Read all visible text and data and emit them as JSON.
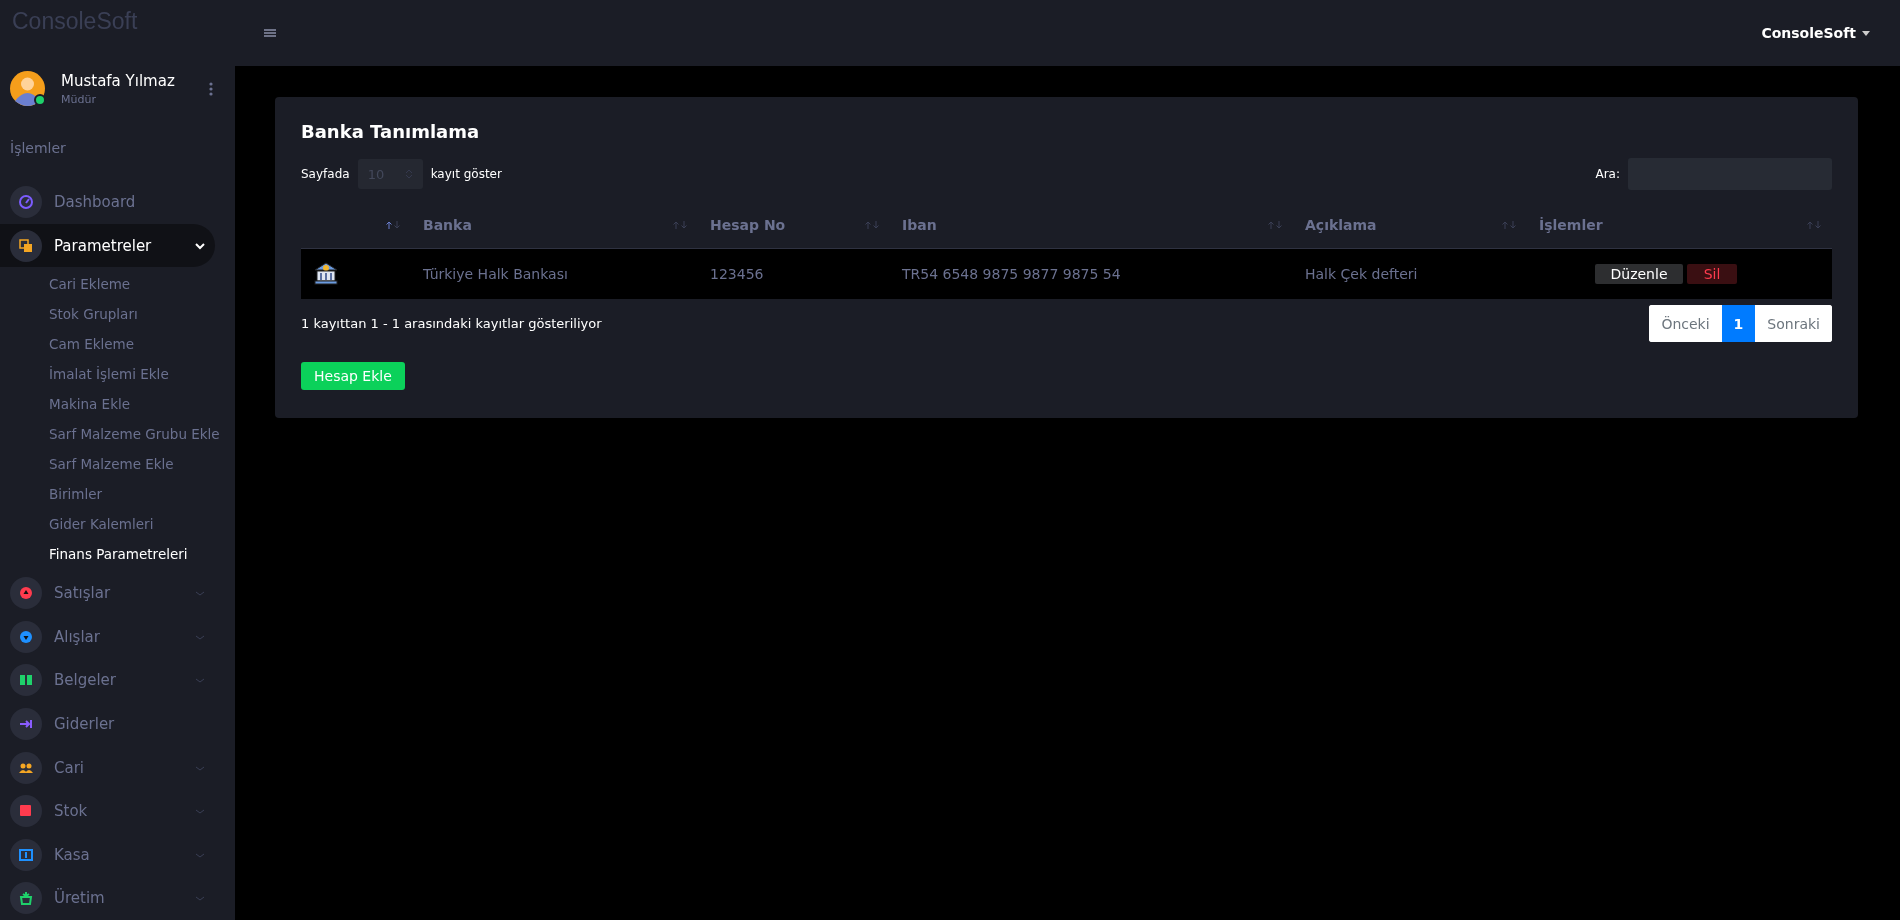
{
  "brand": "ConsoleSoft",
  "topbar": {
    "user_menu": "ConsoleSoft"
  },
  "user": {
    "name": "Mustafa Yılmaz",
    "role": "Müdür",
    "online": true
  },
  "sidebar": {
    "section": "İşlemler",
    "items": [
      {
        "label": "Dashboard",
        "kind": "link",
        "color": "#7c5cff",
        "selected": false
      },
      {
        "label": "Parametreler",
        "kind": "group",
        "color": "#f5a623",
        "selected": true,
        "expanded": true,
        "children": [
          {
            "label": "Cari Ekleme",
            "selected": false
          },
          {
            "label": "Stok Grupları",
            "selected": false
          },
          {
            "label": "Cam Ekleme",
            "selected": false
          },
          {
            "label": "İmalat İşlemi Ekle",
            "selected": false
          },
          {
            "label": "Makina Ekle",
            "selected": false
          },
          {
            "label": "Sarf Malzeme Grubu Ekle",
            "selected": false
          },
          {
            "label": "Sarf Malzeme Ekle",
            "selected": false
          },
          {
            "label": "Birimler",
            "selected": false
          },
          {
            "label": "Gider Kalemleri",
            "selected": false
          },
          {
            "label": "Finans Parametreleri",
            "selected": true
          }
        ]
      },
      {
        "label": "Satışlar",
        "kind": "group",
        "color": "#ff3b4e",
        "selected": false,
        "expanded": false
      },
      {
        "label": "Alışlar",
        "kind": "group",
        "color": "#1e90ff",
        "selected": false,
        "expanded": false
      },
      {
        "label": "Belgeler",
        "kind": "group",
        "color": "#1fd16b",
        "selected": false,
        "expanded": false
      },
      {
        "label": "Giderler",
        "kind": "link",
        "color": "#8a5cff",
        "selected": false
      },
      {
        "label": "Cari",
        "kind": "group",
        "color": "#f5a623",
        "selected": false,
        "expanded": false
      },
      {
        "label": "Stok",
        "kind": "group",
        "color": "#ff3b4e",
        "selected": false,
        "expanded": false
      },
      {
        "label": "Kasa",
        "kind": "group",
        "color": "#1e90ff",
        "selected": false,
        "expanded": false
      },
      {
        "label": "Üretim",
        "kind": "group",
        "color": "#1fd16b",
        "selected": false,
        "expanded": false
      }
    ]
  },
  "card": {
    "title": "Banka Tanımlama",
    "length": {
      "before": "Sayfada",
      "value": "10",
      "after": "kayıt göster"
    },
    "search": {
      "label": "Ara:"
    },
    "table": {
      "icon_column": {
        "sorted": true
      },
      "columns": [
        {
          "label": "Banka",
          "sorted": false
        },
        {
          "label": "Hesap No",
          "sorted": false
        },
        {
          "label": "Iban",
          "sorted": false
        },
        {
          "label": "Açıklama",
          "sorted": false
        },
        {
          "label": "İşlemler",
          "sorted": false
        }
      ],
      "rows": [
        {
          "cells": [
            "Türkiye Halk Bankası",
            "123456",
            "TR54 6548 9875 9877 9875 54",
            "Halk Çek defteri"
          ],
          "actions": [
            {
              "label": "Düzenle",
              "kind": "edit"
            },
            {
              "label": "Sil",
              "kind": "delete"
            }
          ]
        }
      ]
    },
    "info": "1 kayıttan 1 - 1 arasındaki kayıtlar gösteriliyor",
    "pagination": [
      {
        "label": "Önceki",
        "selected": false
      },
      {
        "label": "1",
        "selected": true
      },
      {
        "label": "Sonraki",
        "selected": false
      }
    ],
    "add_button": "Hesap Ekle"
  }
}
